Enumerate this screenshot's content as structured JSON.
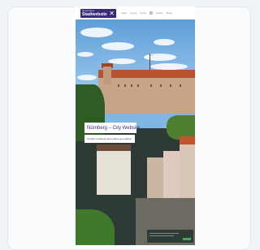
{
  "header": {
    "logo_top": "Nuremberg",
    "logo_name": "Stadtwebsite",
    "logo_mark": "✕",
    "nav": [
      "Stadt",
      "Leben",
      "Kultur",
      "",
      "Suche",
      "Menü"
    ]
  },
  "hero": {
    "title": "Nürnberg – City Website",
    "subtitle": "Tourism, business and culture at a glance"
  },
  "cookie": {
    "accept": "OK"
  },
  "colors": {
    "brand": "#3a2a78",
    "background": "#f1f4f7",
    "accept": "#47a65a"
  }
}
